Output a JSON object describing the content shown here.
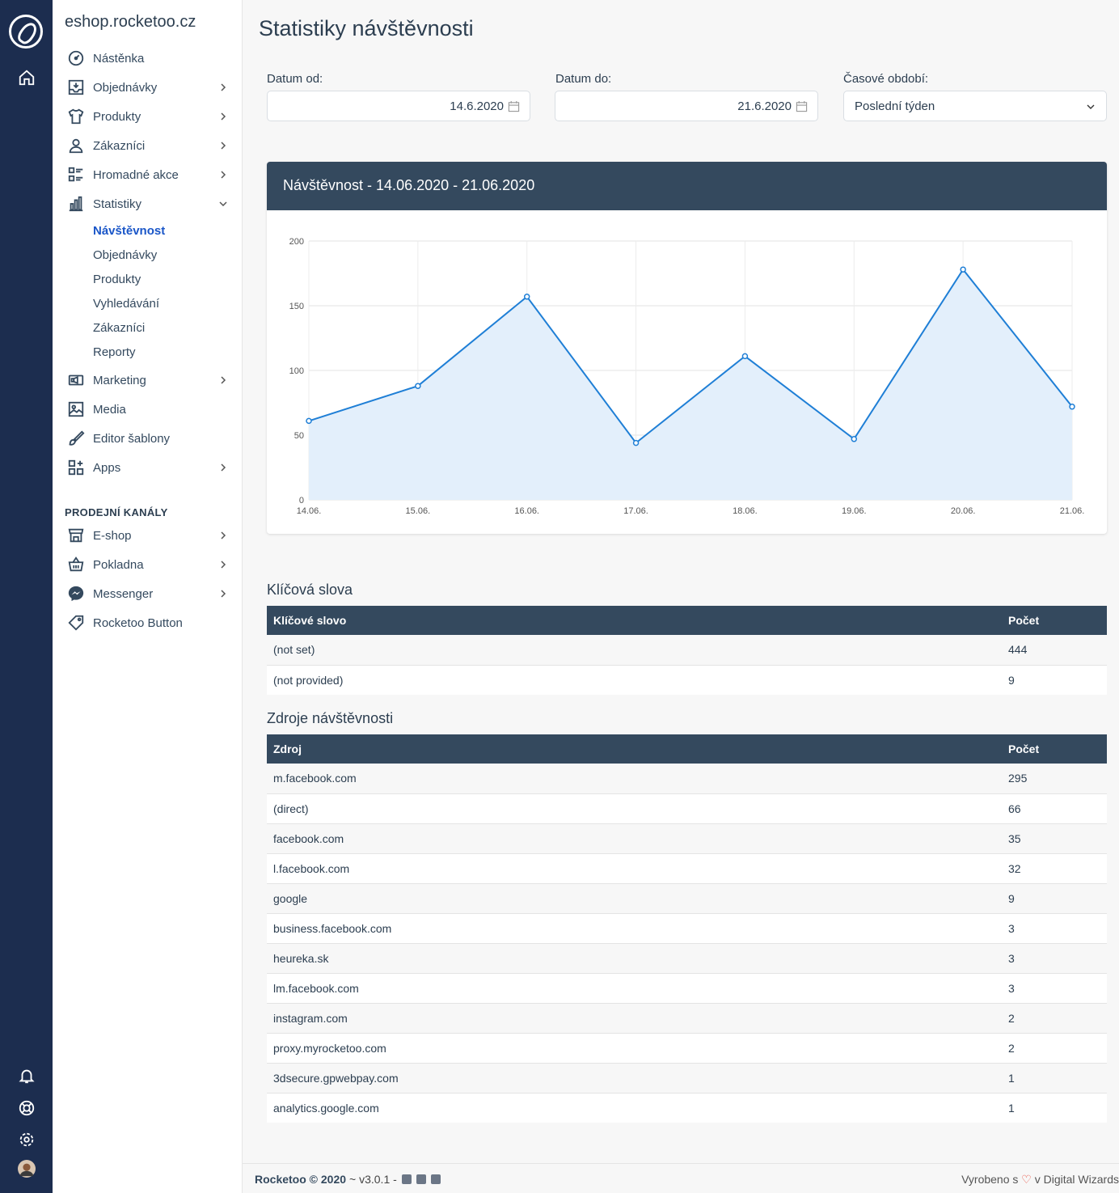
{
  "rail": {
    "icons": [
      "rocket-logo",
      "home-icon",
      "bell-icon",
      "lifebuoy-icon",
      "gear-icon",
      "avatar"
    ]
  },
  "sidebar": {
    "store_name": "eshop.rocketoo.cz",
    "items": [
      {
        "label": "Nástěnka",
        "icon": "dashboard-icon",
        "chevron": false
      },
      {
        "label": "Objednávky",
        "icon": "inbox-icon",
        "chevron": true
      },
      {
        "label": "Produkty",
        "icon": "shirt-icon",
        "chevron": true
      },
      {
        "label": "Zákazníci",
        "icon": "user-icon",
        "chevron": true
      },
      {
        "label": "Hromadné akce",
        "icon": "checklist-icon",
        "chevron": true
      },
      {
        "label": "Statistiky",
        "icon": "bar-chart-icon",
        "chevron": true,
        "expanded": true
      }
    ],
    "statistiky_sub": [
      "Návštěvnost",
      "Objednávky",
      "Produkty",
      "Vyhledávání",
      "Zákazníci",
      "Reporty"
    ],
    "items2": [
      {
        "label": "Marketing",
        "icon": "megaphone-icon",
        "chevron": true
      },
      {
        "label": "Media",
        "icon": "image-icon",
        "chevron": false
      },
      {
        "label": "Editor šablony",
        "icon": "brush-icon",
        "chevron": false
      },
      {
        "label": "Apps",
        "icon": "apps-icon",
        "chevron": true
      }
    ],
    "section_title": "PRODEJNÍ KANÁLY",
    "channels": [
      {
        "label": "E-shop",
        "icon": "store-icon",
        "chevron": true
      },
      {
        "label": "Pokladna",
        "icon": "basket-icon",
        "chevron": true
      },
      {
        "label": "Messenger",
        "icon": "messenger-icon",
        "chevron": true
      },
      {
        "label": "Rocketoo Button",
        "icon": "tag-icon",
        "chevron": false
      }
    ]
  },
  "main": {
    "title": "Statistiky návštěvnosti",
    "date_from_label": "Datum od:",
    "date_from_value": "14.6.2020",
    "date_to_label": "Datum do:",
    "date_to_value": "21.6.2020",
    "period_label": "Časové období:",
    "period_value": "Poslední týden"
  },
  "chart_card": {
    "title": "Návštěvnost - 14.06.2020 - 21.06.2020"
  },
  "chart_data": {
    "type": "area",
    "title": "",
    "xlabel": "",
    "ylabel": "",
    "categories": [
      "14.06.",
      "15.06.",
      "16.06.",
      "17.06.",
      "18.06.",
      "19.06.",
      "20.06.",
      "21.06."
    ],
    "values": [
      61,
      88,
      157,
      44,
      111,
      47,
      178,
      72
    ],
    "ylim": [
      0,
      200
    ],
    "yticks": [
      0,
      50,
      100,
      150,
      200
    ],
    "grid": true,
    "line_color": "#1f7fd6",
    "fill_color": "#e3effb"
  },
  "keywords": {
    "title": "Klíčová slova",
    "headers": [
      "Klíčové slovo",
      "Počet"
    ],
    "rows": [
      [
        "(not set)",
        "444"
      ],
      [
        "(not provided)",
        "9"
      ]
    ]
  },
  "sources": {
    "title": "Zdroje návštěvnosti",
    "headers": [
      "Zdroj",
      "Počet"
    ],
    "rows": [
      [
        "m.facebook.com",
        "295"
      ],
      [
        "(direct)",
        "66"
      ],
      [
        "facebook.com",
        "35"
      ],
      [
        "l.facebook.com",
        "32"
      ],
      [
        "google",
        "9"
      ],
      [
        "business.facebook.com",
        "3"
      ],
      [
        "heureka.sk",
        "3"
      ],
      [
        "lm.facebook.com",
        "3"
      ],
      [
        "instagram.com",
        "2"
      ],
      [
        "proxy.myrocketoo.com",
        "2"
      ],
      [
        "3dsecure.gpwebpay.com",
        "1"
      ],
      [
        "analytics.google.com",
        "1"
      ]
    ]
  },
  "footer": {
    "brand": "Rocketoo © 2020",
    "version": "~ v3.0.1 -",
    "made_prefix": "Vyrobeno s",
    "made_suffix": "v Digital Wizards"
  },
  "colors": {
    "rail": "#1c2d4f",
    "header_dark": "#34495e",
    "active_link": "#1a56c8"
  }
}
